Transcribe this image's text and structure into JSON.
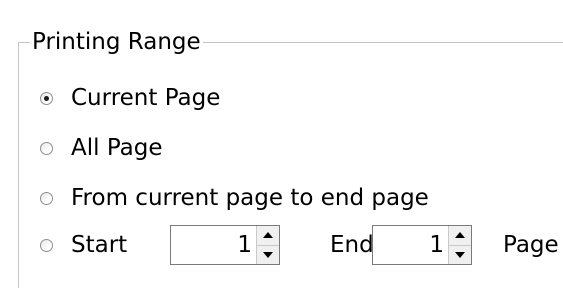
{
  "group": {
    "title": "Printing Range"
  },
  "options": [
    {
      "label": "Current Page",
      "checked": true
    },
    {
      "label": "All Page",
      "checked": false
    },
    {
      "label": "From current page to end page",
      "checked": false
    },
    {
      "label": "Start",
      "checked": false
    }
  ],
  "start": {
    "value": "1"
  },
  "end": {
    "label": "End",
    "value": "1",
    "unit_label": "Page"
  },
  "icons": {
    "spin_up": "up-arrow-icon",
    "spin_down": "down-arrow-icon",
    "radio_checked": "radio-checked-icon",
    "radio_unchecked": "radio-unchecked-icon"
  }
}
